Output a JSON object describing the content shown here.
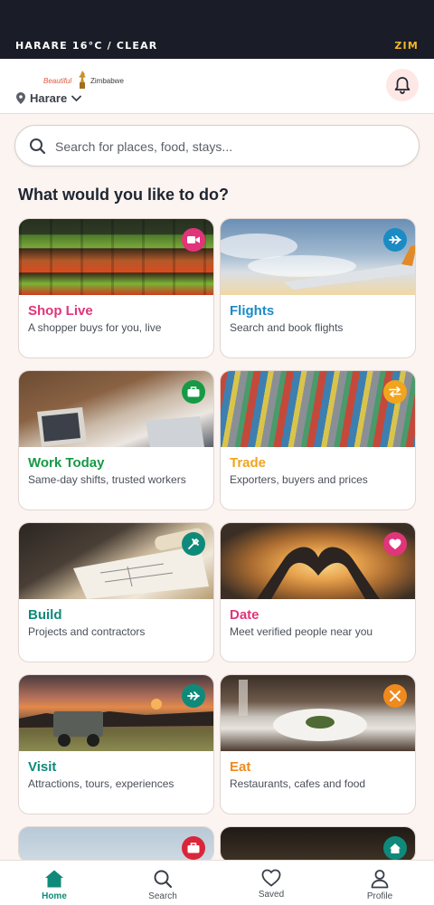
{
  "status_bar": {
    "weather": "HARARE 16°C / CLEAR",
    "country": "ZIM"
  },
  "header": {
    "logo": {
      "word1": "Beautiful",
      "word2": "Zimbabwe"
    },
    "location": "Harare",
    "icons": {
      "location": "map-pin",
      "chevron": "chevron-down",
      "bell": "bell"
    }
  },
  "search": {
    "placeholder": "Search for places, food, stays...",
    "value": ""
  },
  "section_title": "What would you like to do?",
  "cards": [
    {
      "title": "Shop Live",
      "subtitle": "A shopper buys for you, live",
      "title_color": "#e0357a",
      "badge_color": "#e0357a",
      "icon": "video-camera"
    },
    {
      "title": "Flights",
      "subtitle": "Search and book flights",
      "title_color": "#1b8bc4",
      "badge_color": "#1b8bc4",
      "icon": "airplane"
    },
    {
      "title": "Work Today",
      "subtitle": "Same-day shifts, trusted workers",
      "title_color": "#169a44",
      "badge_color": "#169a44",
      "icon": "briefcase"
    },
    {
      "title": "Trade",
      "subtitle": "Exporters, buyers and prices",
      "title_color": "#f0a51d",
      "badge_color": "#f0a51d",
      "icon": "swap-arrows"
    },
    {
      "title": "Build",
      "subtitle": "Projects and contractors",
      "title_color": "#0f8a7a",
      "badge_color": "#0f8a7a",
      "icon": "tools"
    },
    {
      "title": "Date",
      "subtitle": "Meet verified people near you",
      "title_color": "#e0357a",
      "badge_color": "#e0357a",
      "icon": "heart"
    },
    {
      "title": "Visit",
      "subtitle": "Attractions, tours, experiences",
      "title_color": "#0f8a7a",
      "badge_color": "#0f8a7a",
      "icon": "airplane"
    },
    {
      "title": "Eat",
      "subtitle": "Restaurants, cafes and food",
      "title_color": "#f08a1d",
      "badge_color": "#f08a1d",
      "icon": "utensils"
    },
    {
      "title": "",
      "subtitle": "",
      "badge_color": "#d9263a",
      "icon": "suitcase"
    },
    {
      "title": "",
      "subtitle": "",
      "badge_color": "#0f8a7a",
      "icon": "home"
    }
  ],
  "bottom_nav": [
    {
      "label": "Home",
      "icon": "home",
      "active": true
    },
    {
      "label": "Search",
      "icon": "magnifier",
      "active": false
    },
    {
      "label": "Saved",
      "icon": "heart-outline",
      "active": false
    },
    {
      "label": "Profile",
      "icon": "person",
      "active": false
    }
  ],
  "colors": {
    "accent": "#0f8a7a",
    "status_bar_bg": "#1a1d27",
    "page_bg": "#fbf4f1"
  }
}
